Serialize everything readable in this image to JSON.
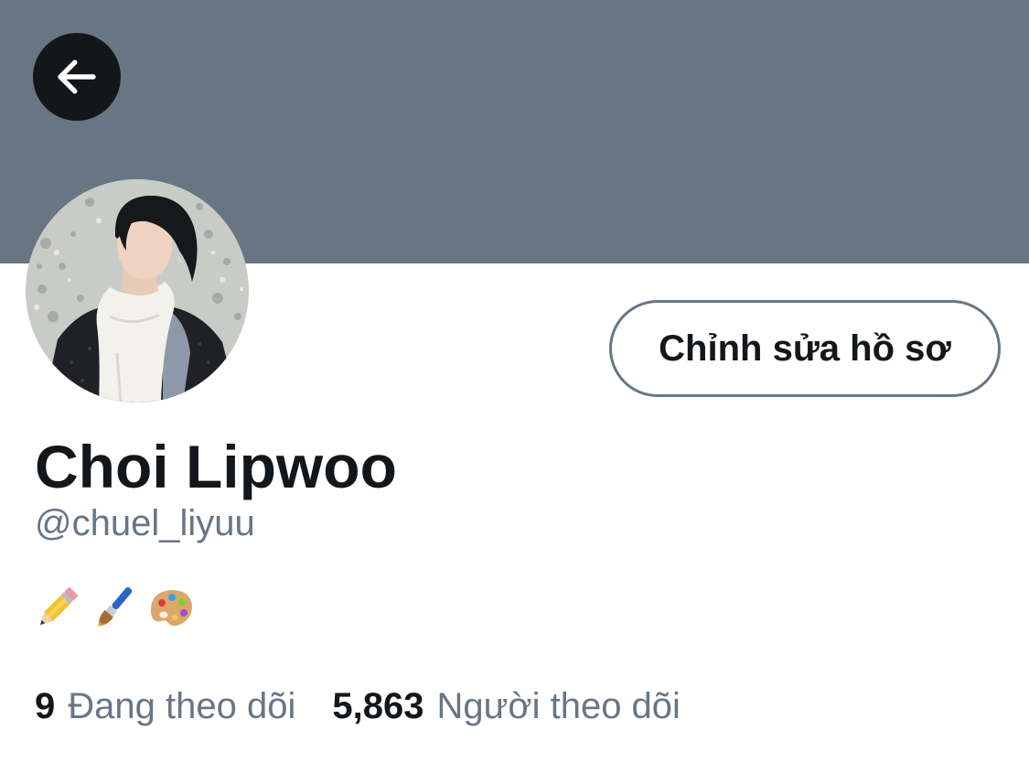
{
  "header": {
    "banner_color": "#687684",
    "back_icon": "arrow-left-icon"
  },
  "profile": {
    "display_name": "Choi Lipwoo",
    "username": "@chuel_liyuu",
    "edit_button_label": "Chỉnh sửa hồ sơ",
    "bio_icons": [
      "pencil-icon",
      "paintbrush-icon",
      "palette-icon"
    ]
  },
  "stats": {
    "following_count": "9",
    "following_label": "Đang theo dõi",
    "followers_count": "5,863",
    "followers_label": "Người theo dõi"
  },
  "colors": {
    "text_primary": "#14171a",
    "text_secondary": "#687684",
    "background": "#ffffff"
  }
}
